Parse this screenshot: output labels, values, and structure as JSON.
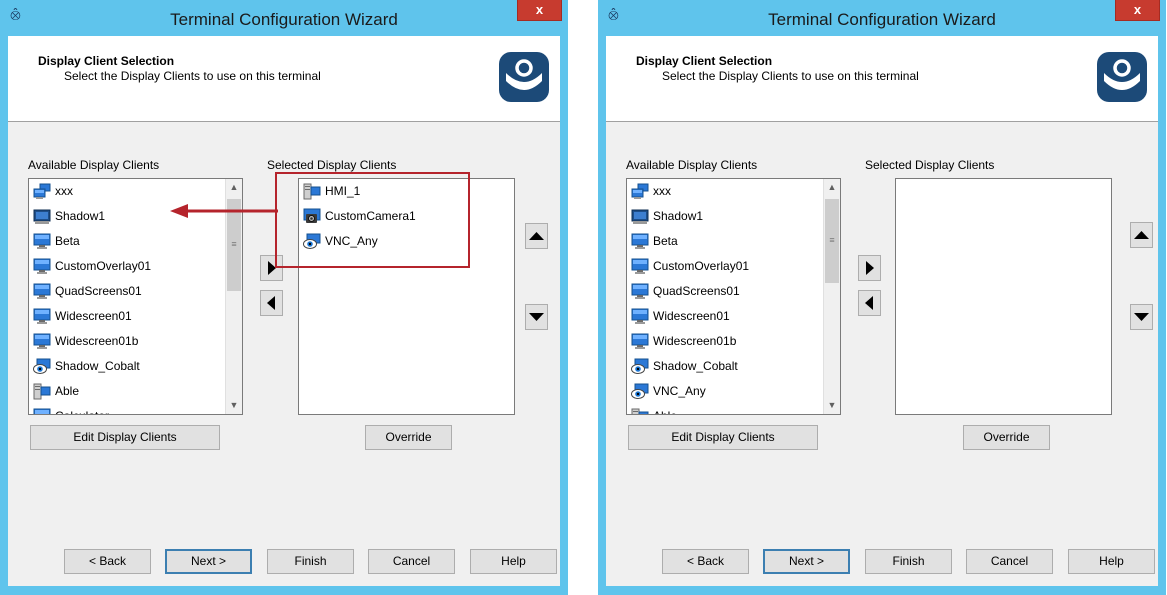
{
  "colors": {
    "frame": "#5fc4ec",
    "close": "#c73b2f",
    "highlight": "#b5242c"
  },
  "windows": [
    {
      "title": "Terminal Configuration Wizard",
      "close_label": "x",
      "header_title": "Display Client Selection",
      "header_subtitle": "Select the Display Clients to use on this terminal",
      "available_label": "Available Display Clients",
      "selected_label": "Selected Display Clients",
      "available": [
        {
          "label": "xxx",
          "icon": "display-group-icon"
        },
        {
          "label": "Shadow1",
          "icon": "shadow-monitor-icon"
        },
        {
          "label": "Beta",
          "icon": "monitor-icon"
        },
        {
          "label": "CustomOverlay01",
          "icon": "monitor-icon"
        },
        {
          "label": "QuadScreens01",
          "icon": "monitor-icon"
        },
        {
          "label": "Widescreen01",
          "icon": "monitor-icon"
        },
        {
          "label": "Widescreen01b",
          "icon": "monitor-icon"
        },
        {
          "label": "Shadow_Cobalt",
          "icon": "vnc-eye-icon"
        },
        {
          "label": "Able",
          "icon": "hmi-terminal-icon"
        },
        {
          "label": "Calculator",
          "icon": "monitor-icon"
        }
      ],
      "selected": [
        {
          "label": "HMI_1",
          "icon": "hmi-terminal-icon"
        },
        {
          "label": "CustomCamera1",
          "icon": "camera-icon"
        },
        {
          "label": "VNC_Any",
          "icon": "vnc-eye-icon"
        }
      ],
      "edit_button": "Edit Display Clients",
      "override_button": "Override",
      "back_button": "< Back",
      "next_button": "Next >",
      "finish_button": "Finish",
      "cancel_button": "Cancel",
      "help_button": "Help"
    },
    {
      "title": "Terminal Configuration Wizard",
      "close_label": "x",
      "header_title": "Display Client Selection",
      "header_subtitle": "Select the Display Clients to use on this terminal",
      "available_label": "Available Display Clients",
      "selected_label": "Selected Display Clients",
      "available": [
        {
          "label": "xxx",
          "icon": "display-group-icon"
        },
        {
          "label": "Shadow1",
          "icon": "shadow-monitor-icon"
        },
        {
          "label": "Beta",
          "icon": "monitor-icon"
        },
        {
          "label": "CustomOverlay01",
          "icon": "monitor-icon"
        },
        {
          "label": "QuadScreens01",
          "icon": "monitor-icon"
        },
        {
          "label": "Widescreen01",
          "icon": "monitor-icon"
        },
        {
          "label": "Widescreen01b",
          "icon": "monitor-icon"
        },
        {
          "label": "Shadow_Cobalt",
          "icon": "vnc-eye-icon"
        },
        {
          "label": "VNC_Any",
          "icon": "vnc-eye-icon"
        },
        {
          "label": "Able",
          "icon": "hmi-terminal-icon"
        }
      ],
      "selected": [],
      "edit_button": "Edit Display Clients",
      "override_button": "Override",
      "back_button": "< Back",
      "next_button": "Next >",
      "finish_button": "Finish",
      "cancel_button": "Cancel",
      "help_button": "Help"
    }
  ]
}
